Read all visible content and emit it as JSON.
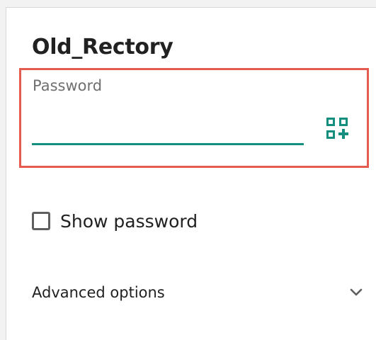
{
  "dialog": {
    "network_name": "Old_Rectory",
    "password": {
      "label": "Password",
      "value": ""
    },
    "qr_icon": "qr-code-add-icon",
    "show_password": {
      "label": "Show password",
      "checked": false
    },
    "advanced": {
      "label": "Advanced options",
      "icon": "chevron-down-icon"
    }
  },
  "colors": {
    "accent": "#148f7f",
    "highlight": "#e45b4f",
    "text": "#212121",
    "label": "#6f6f6f"
  }
}
